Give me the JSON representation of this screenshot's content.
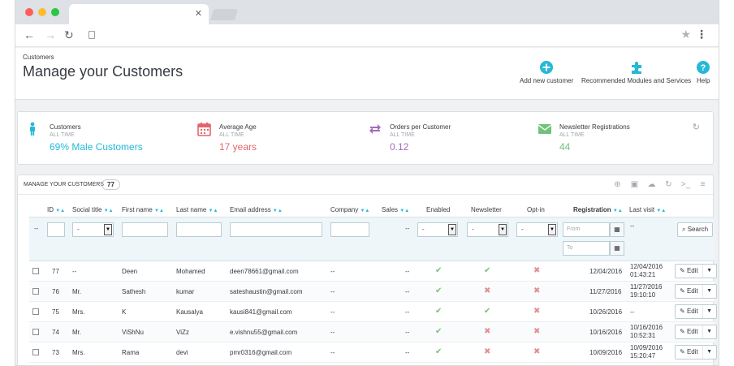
{
  "breadcrumb": "Customers",
  "page_title": "Manage your Customers",
  "toolbar": {
    "add_label": "Add new customer",
    "modules_label": "Recommended Modules and Services",
    "help_label": "Help"
  },
  "kpis": [
    {
      "title": "Customers",
      "subtitle": "ALL TIME",
      "value": "69% Male Customers",
      "color": "#25b9d7",
      "icon": "person-icon"
    },
    {
      "title": "Average Age",
      "subtitle": "ALL TIME",
      "value": "17 years",
      "color": "#e3646d",
      "icon": "calendar-icon"
    },
    {
      "title": "Orders per Customer",
      "subtitle": "ALL TIME",
      "value": "0.12",
      "color": "#a46cbd",
      "icon": "repeat-icon"
    },
    {
      "title": "Newsletter Registrations",
      "subtitle": "ALL TIME",
      "value": "44",
      "color": "#72c279",
      "icon": "envelope-icon"
    }
  ],
  "panel": {
    "title": "MANAGE YOUR CUSTOMERS",
    "count": "77"
  },
  "columns": {
    "id": "ID",
    "social_title": "Social title",
    "first_name": "First name",
    "last_name": "Last name",
    "email": "Email address",
    "company": "Company",
    "sales": "Sales",
    "enabled": "Enabled",
    "newsletter": "Newsletter",
    "optin": "Opt-in",
    "registration": "Registration",
    "last_visit": "Last visit"
  },
  "filters": {
    "dash": "--",
    "social_value": "-",
    "enabled_value": "-",
    "newsletter_value": "-",
    "optin_value": "-",
    "from_placeholder": "From",
    "to_placeholder": "To",
    "sales_dash": "--",
    "lastvisit_dash": "--",
    "search_label": "Search"
  },
  "rows": [
    {
      "id": "77",
      "social": "--",
      "first": "Deen",
      "last": "Mohamed",
      "email": "deen78661@gmail.com",
      "company": "--",
      "sales": "--",
      "enabled": true,
      "newsletter": true,
      "optin": false,
      "registration": "12/04/2016",
      "last_visit_date": "12/04/2016",
      "last_visit_time": "01:43:21",
      "edit": "Edit"
    },
    {
      "id": "76",
      "social": "Mr.",
      "first": "Sathesh",
      "last": "kumar",
      "email": "sateshaustin@gmail.com",
      "company": "--",
      "sales": "--",
      "enabled": true,
      "newsletter": false,
      "optin": false,
      "registration": "11/27/2016",
      "last_visit_date": "11/27/2016",
      "last_visit_time": "19:10:10",
      "edit": "Edit"
    },
    {
      "id": "75",
      "social": "Mrs.",
      "first": "K",
      "last": "Kausalya",
      "email": "kausi841@gmail.com",
      "company": "--",
      "sales": "--",
      "enabled": true,
      "newsletter": true,
      "optin": false,
      "registration": "10/26/2016",
      "last_visit_date": "--",
      "last_visit_time": "",
      "edit": "Edit"
    },
    {
      "id": "74",
      "social": "Mr.",
      "first": "ViShNu",
      "last": "ViZz",
      "email": "e.vishnu55@gmail.com",
      "company": "--",
      "sales": "--",
      "enabled": true,
      "newsletter": false,
      "optin": false,
      "registration": "10/16/2016",
      "last_visit_date": "10/16/2016",
      "last_visit_time": "10:52:31",
      "edit": "Edit"
    },
    {
      "id": "73",
      "social": "Mrs.",
      "first": "Rama",
      "last": "devi",
      "email": "pmr0316@gmail.com",
      "company": "--",
      "sales": "--",
      "enabled": true,
      "newsletter": false,
      "optin": false,
      "registration": "10/09/2016",
      "last_visit_date": "10/09/2016",
      "last_visit_time": "15:20:47",
      "edit": "Edit"
    }
  ]
}
